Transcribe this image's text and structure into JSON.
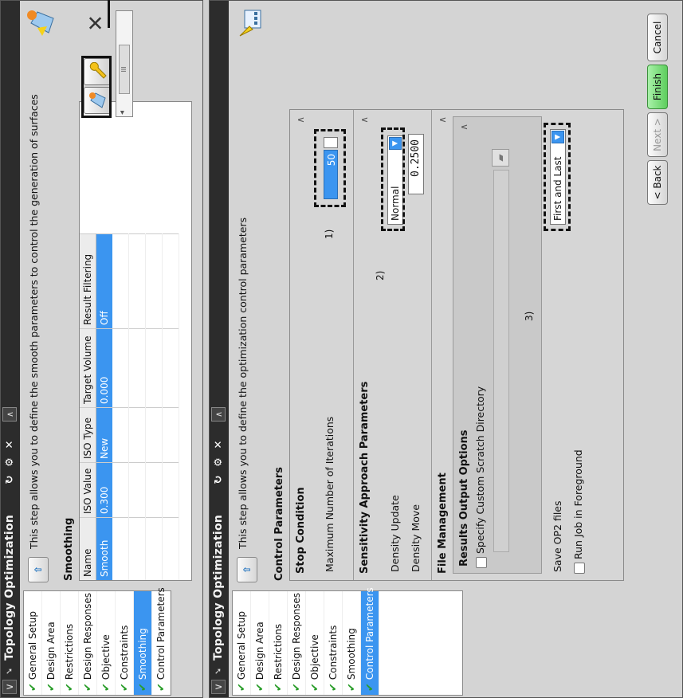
{
  "window_title": "Topology Optimization",
  "steps": [
    "General Setup",
    "Design Area",
    "Restrictions",
    "Design Responses",
    "Objective",
    "Constraints",
    "Smoothing",
    "Control Parameters"
  ],
  "panel_top": {
    "active_step_index": 6,
    "description": "This step allows you to define the smooth parameters to control the generation of surfaces",
    "section_title": "Smoothing",
    "table": {
      "headers": [
        "Name",
        "ISO Value",
        "ISO Type",
        "Target Volume",
        "Result Filtering"
      ],
      "rows": [
        [
          "Smooth",
          "0.300",
          "New",
          "0.000",
          "Off"
        ]
      ]
    },
    "scroll_thumb_label": "III"
  },
  "panel_bottom": {
    "active_step_index": 7,
    "description": "This step allows you to define the optimization control parameters",
    "section_title": "Control Parameters",
    "stop_condition": {
      "title": "Stop Condition",
      "max_iter_label": "Maximum Number of Iterations",
      "max_iter_value": "50",
      "marker": "1)"
    },
    "sensitivity": {
      "title": "Sensitivity Approach Parameters",
      "density_update_label": "Density Update",
      "density_update_value": "Normal",
      "density_move_label": "Density Move",
      "density_move_value": "0.2500",
      "marker": "2)"
    },
    "file_management": {
      "title": "File Management",
      "results_output": {
        "title": "Results Output Options",
        "scratch_label": "Specify Custom Scratch Directory",
        "marker": "3)"
      },
      "save_op2_label": "Save OP2 files",
      "save_op2_value": "First and Last",
      "foreground_label": "Run Job in Foreground"
    },
    "footer": {
      "back": "< Back",
      "next": "Next >",
      "finish": "Finish",
      "cancel": "Cancel"
    }
  },
  "colors": {
    "accent": "#3b95f0",
    "finish": "#5dcd5d",
    "check": "#2a9d2a",
    "titlebar": "#2c2c2c"
  },
  "icons": {
    "collapse": "chevron-up-icon",
    "pin": "pin-icon",
    "refresh": "refresh-icon",
    "settings": "gear-icon",
    "close": "close-icon",
    "up_arrow": "up-arrow-icon"
  }
}
